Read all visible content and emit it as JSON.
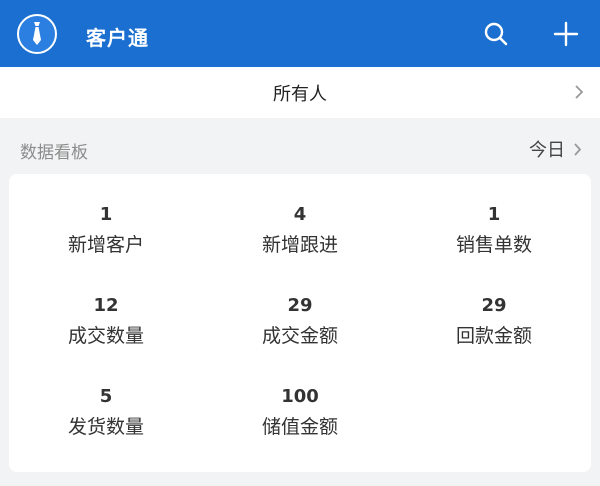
{
  "header": {
    "title": "客户通",
    "logo_icon": "necktie-logo-icon",
    "search_icon": "search-icon",
    "add_icon": "plus-icon",
    "bg_color": "#1a6fd0"
  },
  "filter": {
    "owner_label": "所有人",
    "chevron_icon": "chevron-right-icon"
  },
  "dashboard": {
    "title": "数据看板",
    "period_label": "今日",
    "stats": [
      {
        "value": "1",
        "label": "新增客户"
      },
      {
        "value": "4",
        "label": "新增跟进"
      },
      {
        "value": "1",
        "label": "销售单数"
      },
      {
        "value": "12",
        "label": "成交数量"
      },
      {
        "value": "29",
        "label": "成交金额"
      },
      {
        "value": "29",
        "label": "回款金额"
      },
      {
        "value": "5",
        "label": "发货数量"
      },
      {
        "value": "100",
        "label": "储值金额"
      }
    ]
  }
}
